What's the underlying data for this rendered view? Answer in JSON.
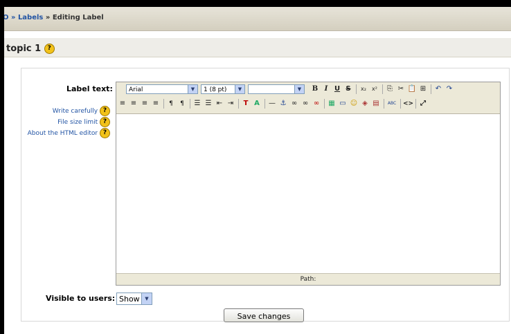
{
  "breadcrumb": {
    "prefix": "O »",
    "link": "Labels",
    "separator": "»",
    "current": "Editing Label"
  },
  "topic": {
    "title": "topic 1",
    "help": "?"
  },
  "form": {
    "label_text": "Label text:",
    "help_links": [
      "Write carefully",
      "File size limit",
      "About the HTML editor"
    ],
    "help_glyph": "?",
    "visible_label": "Visible to users:",
    "visible_value": "Show",
    "save_label": "Save changes"
  },
  "editor": {
    "font": "Arial",
    "size": "1 (8 pt)",
    "style": "",
    "path_label": "Path:",
    "toolbar_row1": [
      "B",
      "I",
      "U",
      "S",
      "x₂",
      "x²",
      "⎘",
      "✂",
      "📋",
      "⊞",
      "↶",
      "↷"
    ],
    "toolbar_row2": [
      "≡",
      "≡",
      "≡",
      "≡",
      "¶",
      "¶",
      "☰",
      "☰",
      "⇤",
      "⇥",
      "T",
      "A",
      "—",
      "⚓",
      "∞",
      "∞",
      "∞",
      "▦",
      "▭",
      "☺",
      "◈",
      "▤",
      "ABC",
      "<>",
      "⤢"
    ]
  },
  "icons": {
    "help": "help-icon",
    "dropdown": "chevron-down-icon"
  },
  "colors": {
    "link": "#2254a4",
    "help_icon": "#f2c21a",
    "toolbar": "#ece9d8"
  }
}
